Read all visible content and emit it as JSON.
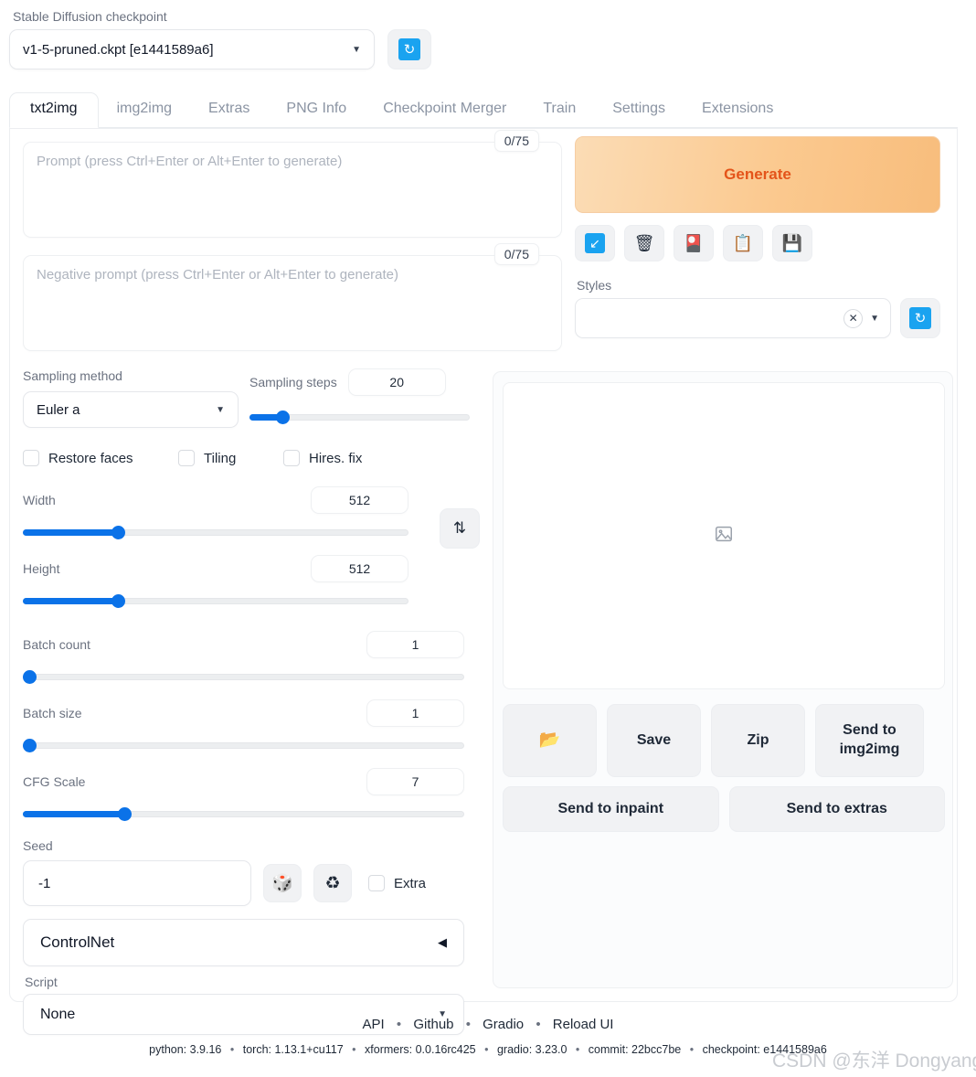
{
  "checkpoint": {
    "label": "Stable Diffusion checkpoint",
    "value": "v1-5-pruned.ckpt [e1441589a6]",
    "caret": "▼",
    "refresh_icon": "↻"
  },
  "tabs": [
    {
      "label": "txt2img",
      "active": true
    },
    {
      "label": "img2img",
      "active": false
    },
    {
      "label": "Extras",
      "active": false
    },
    {
      "label": "PNG Info",
      "active": false
    },
    {
      "label": "Checkpoint Merger",
      "active": false
    },
    {
      "label": "Train",
      "active": false
    },
    {
      "label": "Settings",
      "active": false
    },
    {
      "label": "Extensions",
      "active": false
    }
  ],
  "prompt": {
    "placeholder": "Prompt (press Ctrl+Enter or Alt+Enter to generate)",
    "value": "",
    "counter": "0/75"
  },
  "negative_prompt": {
    "placeholder": "Negative prompt (press Ctrl+Enter or Alt+Enter to generate)",
    "value": "",
    "counter": "0/75"
  },
  "generate": {
    "label": "Generate",
    "color": "#e4541a"
  },
  "tool_buttons": [
    {
      "name": "arrow-down-left-icon",
      "glyph": "↙"
    },
    {
      "name": "trash-icon",
      "glyph": "🗑"
    },
    {
      "name": "art-card-icon",
      "glyph": "🎴"
    },
    {
      "name": "clipboard-icon",
      "glyph": "📋"
    },
    {
      "name": "floppy-save-icon",
      "glyph": "💾"
    }
  ],
  "styles": {
    "label": "Styles",
    "value": "",
    "clear_glyph": "✕",
    "caret": "▼",
    "refresh_icon": "↻"
  },
  "sampling": {
    "method_label": "Sampling method",
    "method_value": "Euler a",
    "steps_label": "Sampling steps",
    "steps_value": "20",
    "steps_percent": 17
  },
  "checkboxes": [
    {
      "label": "Restore faces",
      "checked": false
    },
    {
      "label": "Tiling",
      "checked": false
    },
    {
      "label": "Hires. fix",
      "checked": false
    }
  ],
  "width": {
    "label": "Width",
    "value": "512",
    "percent": 25
  },
  "height": {
    "label": "Height",
    "value": "512",
    "percent": 25
  },
  "swap_button": {
    "glyph": "⇅"
  },
  "batch_count": {
    "label": "Batch count",
    "value": "1",
    "percent": 0
  },
  "batch_size": {
    "label": "Batch size",
    "value": "1",
    "percent": 0
  },
  "cfg_scale": {
    "label": "CFG Scale",
    "value": "7",
    "percent": 23
  },
  "seed": {
    "label": "Seed",
    "value": "-1",
    "dice_icon": "🎲",
    "recycle_icon": "♻",
    "extra_label": "Extra",
    "extra_checked": false
  },
  "controlnet": {
    "label": "ControlNet",
    "caret": "◀"
  },
  "script": {
    "label": "Script",
    "value": "None",
    "caret": "▼"
  },
  "results": {
    "placeholder_icon": "image-placeholder",
    "buttons_row1": [
      {
        "label": "📂",
        "name": "open-folder-button"
      },
      {
        "label": "Save",
        "name": "save-button"
      },
      {
        "label": "Zip",
        "name": "zip-button"
      },
      {
        "label": "Send to img2img",
        "name": "send-to-img2img-button"
      }
    ],
    "buttons_row2": [
      {
        "label": "Send to inpaint",
        "name": "send-to-inpaint-button"
      },
      {
        "label": "Send to extras",
        "name": "send-to-extras-button"
      }
    ]
  },
  "footer": {
    "links": [
      "API",
      "Github",
      "Gradio",
      "Reload UI"
    ],
    "separator": "•",
    "versions": [
      "python: 3.9.16",
      "torch: 1.13.1+cu117",
      "xformers: 0.0.16rc425",
      "gradio: 3.23.0",
      "commit: 22bcc7be",
      "checkpoint: e1441589a6"
    ],
    "watermark": "CSDN @东洋 Dongyang"
  }
}
